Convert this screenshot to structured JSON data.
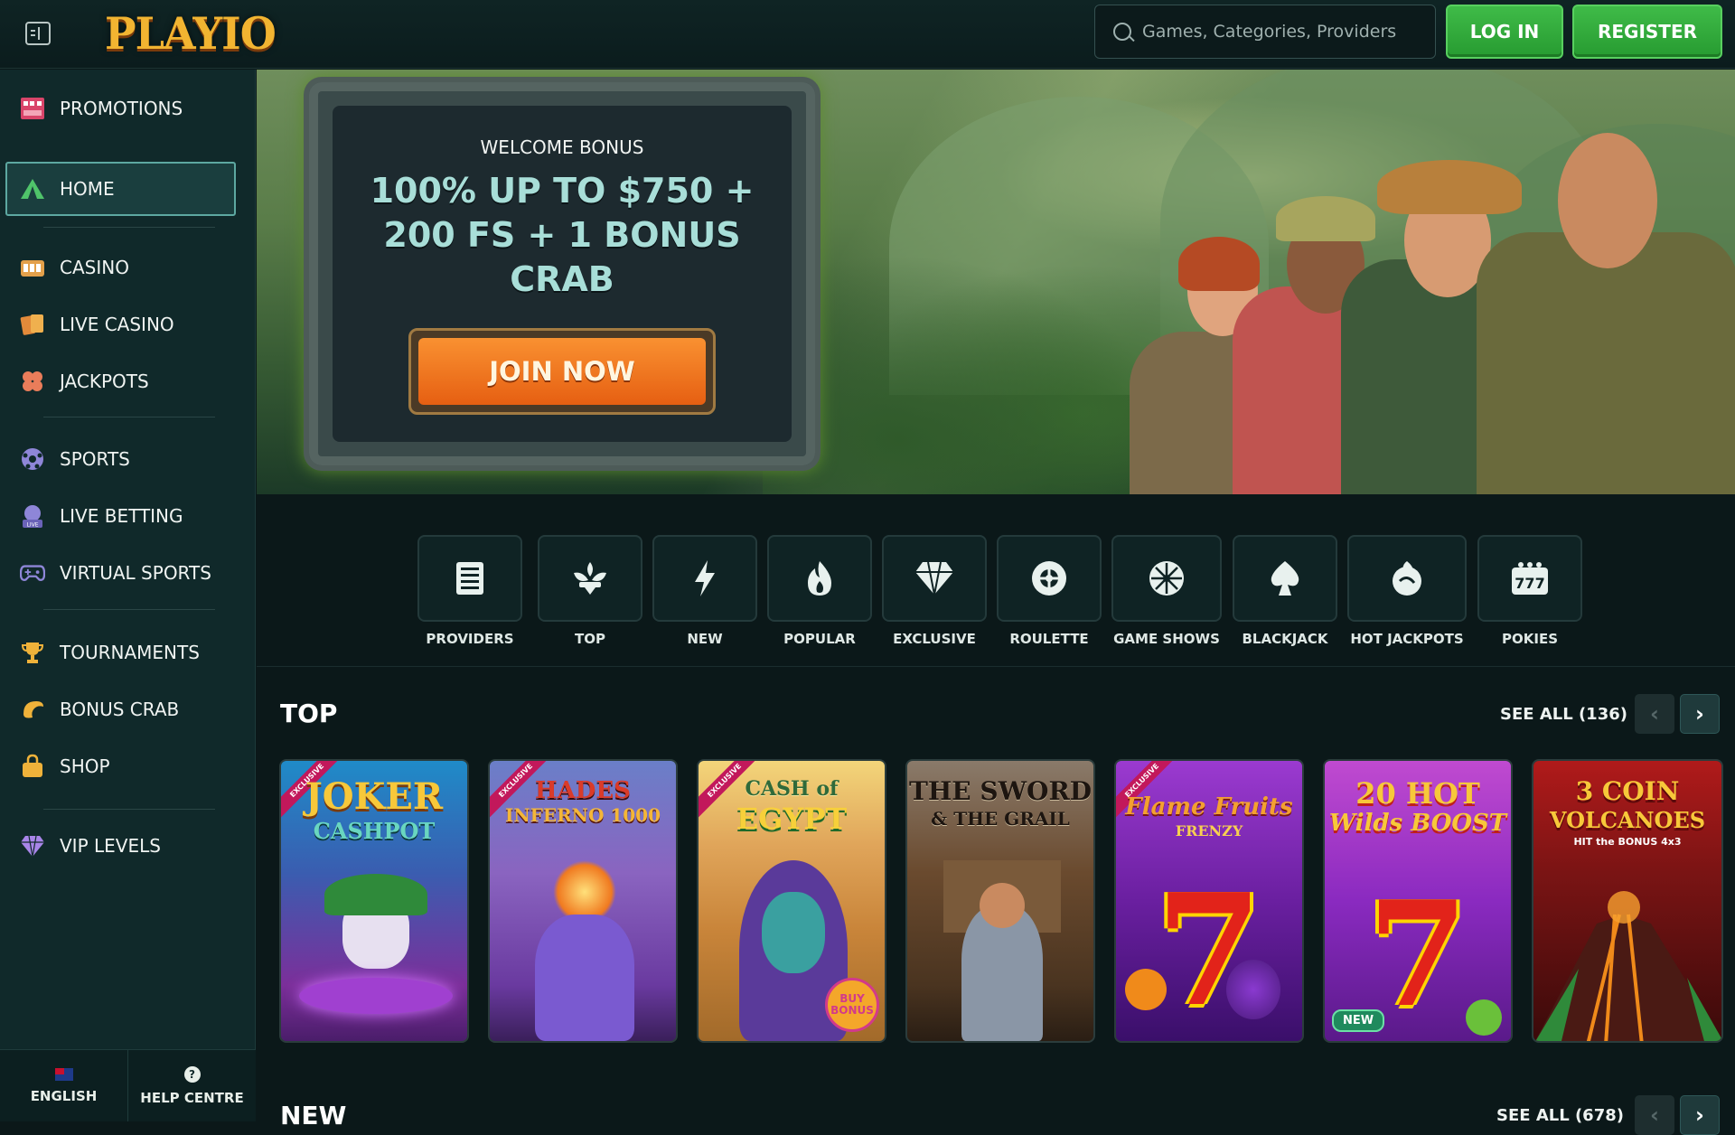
{
  "header": {
    "logo": "PLAYIO",
    "search_placeholder": "Games, Categories, Providers",
    "login_label": "LOG IN",
    "register_label": "REGISTER"
  },
  "sidebar": {
    "items": [
      {
        "label": "PROMOTIONS",
        "icon": "gift-icon"
      },
      {
        "label": "HOME",
        "icon": "tent-icon",
        "active": true
      },
      {
        "label": "CASINO",
        "icon": "slot-machine-icon"
      },
      {
        "label": "LIVE CASINO",
        "icon": "cards-icon"
      },
      {
        "label": "JACKPOTS",
        "icon": "clover-icon"
      },
      {
        "label": "SPORTS",
        "icon": "soccer-ball-icon"
      },
      {
        "label": "LIVE BETTING",
        "icon": "live-icon"
      },
      {
        "label": "VIRTUAL SPORTS",
        "icon": "gamepad-icon"
      },
      {
        "label": "TOURNAMENTS",
        "icon": "trophy-icon"
      },
      {
        "label": "BONUS CRAB",
        "icon": "crab-icon"
      },
      {
        "label": "SHOP",
        "icon": "shopping-bag-icon"
      },
      {
        "label": "VIP LEVELS",
        "icon": "diamond-icon"
      }
    ],
    "footer": {
      "language": "ENGLISH",
      "help": "HELP CENTRE"
    }
  },
  "hero": {
    "welcome": "WELCOME BONUS",
    "offer_line1": "100% UP TO $750 +",
    "offer_line2": "200 FS + 1 BONUS",
    "offer_line3": "CRAB",
    "cta": "JOIN NOW"
  },
  "categories": [
    {
      "label": "PROVIDERS",
      "icon": "book-icon"
    },
    {
      "label": "TOP",
      "icon": "fleur-icon"
    },
    {
      "label": "NEW",
      "icon": "lightning-icon"
    },
    {
      "label": "POPULAR",
      "icon": "fire-icon"
    },
    {
      "label": "EXCLUSIVE",
      "icon": "diamond-icon"
    },
    {
      "label": "ROULETTE",
      "icon": "roulette-icon"
    },
    {
      "label": "GAME SHOWS",
      "icon": "wheel-icon"
    },
    {
      "label": "BLACKJACK",
      "icon": "spade-icon"
    },
    {
      "label": "HOT JACKPOTS",
      "icon": "hot-pot-icon"
    },
    {
      "label": "POKIES",
      "icon": "slot-777-icon"
    }
  ],
  "top_section": {
    "title": "TOP",
    "see_all": "SEE ALL (136)",
    "games": [
      {
        "title_line1": "JOKER",
        "title_line2": "CASHPOT",
        "exclusive": "EXCLUSIVE",
        "bg": "#4a2a7a"
      },
      {
        "title_line1": "HADES",
        "title_line2": "INFERNO 1000",
        "exclusive": "EXCLUSIVE",
        "bg": "#5b3a8a"
      },
      {
        "title_line1": "CASH of",
        "title_line2": "EGYPT",
        "exclusive": "EXCLUSIVE",
        "badge": "BUY BONUS",
        "bg": "#c98a3a"
      },
      {
        "title_line1": "THE SWORD",
        "title_line2": "& THE GRAIL",
        "bg": "#6a4a2e"
      },
      {
        "title_line1": "Flame Fruits",
        "title_line2": "FRENZY",
        "exclusive": "EXCLUSIVE",
        "bg": "#5b1f8a"
      },
      {
        "title_line1": "20 HOT",
        "title_line2": "Wilds BOOST",
        "new": "NEW",
        "bg": "#6a1fa0"
      },
      {
        "title_line1": "3 COIN",
        "title_line2": "VOLCANOES",
        "subtitle": "HIT the BONUS 4x3",
        "bg": "#7a1a12"
      }
    ]
  },
  "new_section": {
    "title": "NEW",
    "see_all": "SEE ALL (678)"
  }
}
